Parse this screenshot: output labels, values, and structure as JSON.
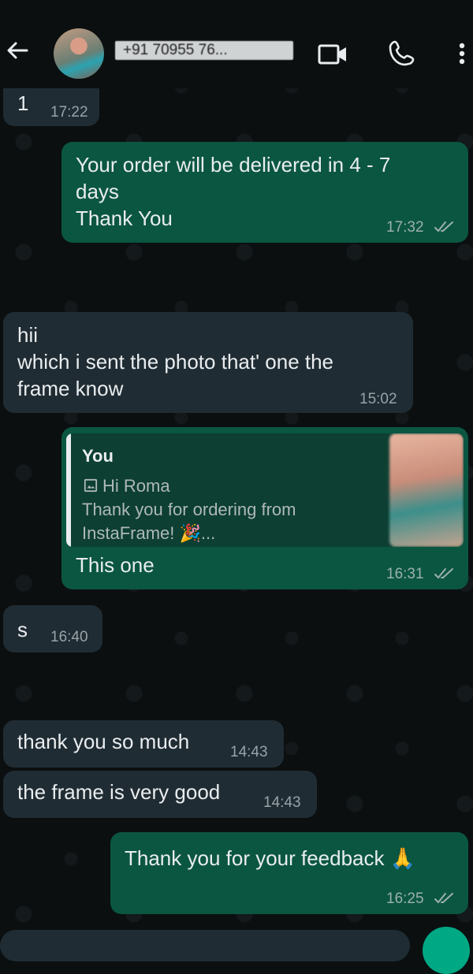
{
  "header": {
    "contact_name": "+91 70955 76...",
    "back_icon": "arrow-left-icon",
    "video_icon": "video-camera-icon",
    "call_icon": "phone-icon",
    "menu_icon": "more-vertical-icon"
  },
  "messages": [
    {
      "dir": "in",
      "text": "1",
      "time": "17:22"
    },
    {
      "dir": "out",
      "text": "Your order will be delivered in 4 - 7 days\nThank You",
      "line1": "Your order will be delivered in 4 - 7",
      "line2": "days",
      "line3": "Thank You",
      "time": "17:32"
    },
    {
      "dir": "in",
      "line1": "hii",
      "line2": "which i sent the photo that' one the",
      "line3": "frame know",
      "time": "15:02"
    },
    {
      "dir": "out",
      "quote_author": "You",
      "quote_line1": "Hi Roma",
      "quote_line2": "Thank you for ordering from",
      "quote_line3": "InstaFrame! 🎉...",
      "text": "This one",
      "time": "16:31"
    },
    {
      "dir": "in",
      "text": "s",
      "time": "16:40"
    },
    {
      "dir": "in",
      "text": "thank you so much",
      "time": "14:43"
    },
    {
      "dir": "in",
      "text": "the frame is very good",
      "time": "14:43"
    },
    {
      "dir": "out",
      "text": "Thank you for your feedback 🙏",
      "time": "16:25"
    }
  ],
  "colors": {
    "background": "#0b0f10",
    "incoming_bubble": "#202c33",
    "outgoing_bubble": "#0b5641",
    "accent": "#00a884"
  }
}
